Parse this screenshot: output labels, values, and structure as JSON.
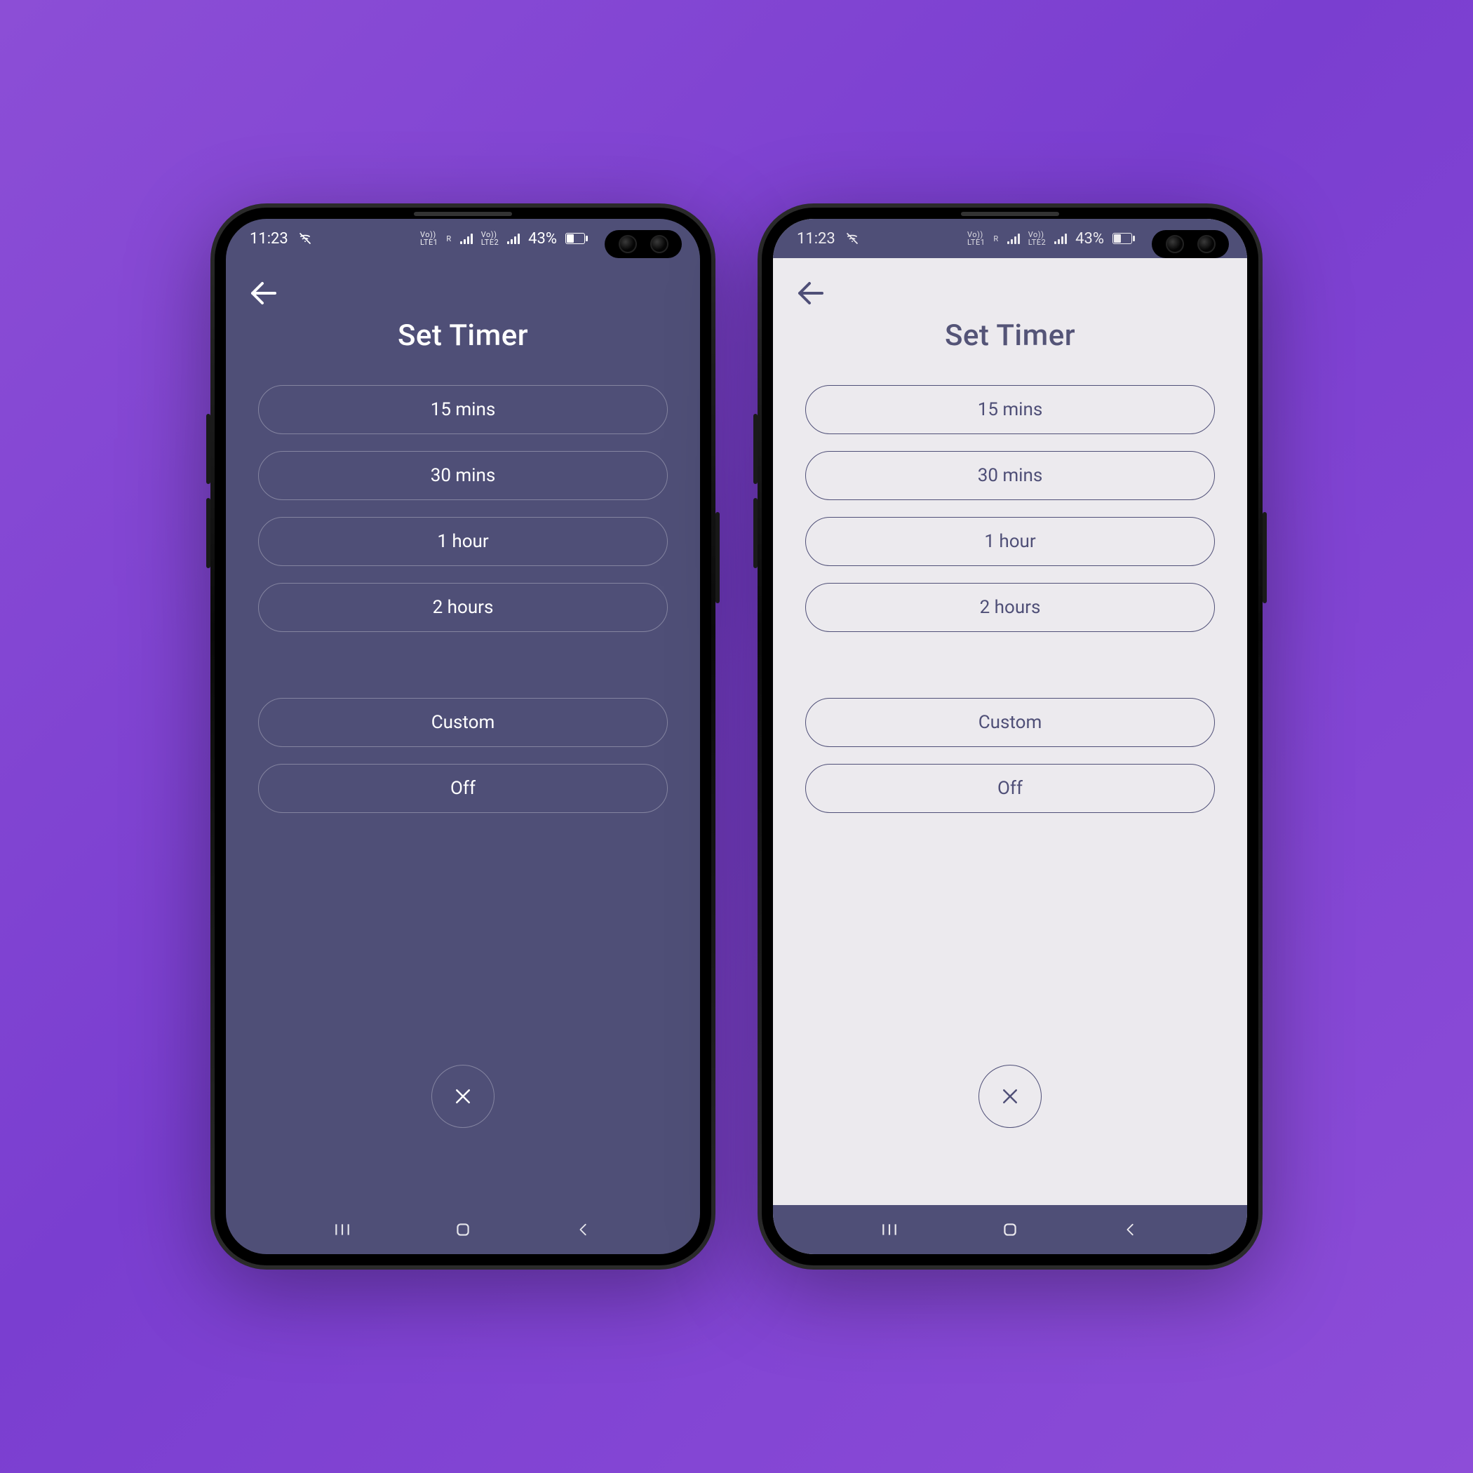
{
  "status": {
    "time": "11:23",
    "battery_pct": "43%",
    "sim1_top": "Vo))",
    "sim1_bot": "LTE1",
    "sim1_flag": "R",
    "sim2_top": "Vo))",
    "sim2_bot": "LTE2"
  },
  "screens": [
    {
      "theme": "dark",
      "title": "Set Timer"
    },
    {
      "theme": "light",
      "title": "Set Timer"
    }
  ],
  "timer_options": {
    "group_a": [
      "15 mins",
      "30 mins",
      "1 hour",
      "2 hours"
    ],
    "group_b": [
      "Custom",
      "Off"
    ]
  },
  "colors": {
    "brand_navy": "#4f4f77",
    "surface_light": "#eceaee",
    "bg_gradient_from": "#8c4ed6",
    "bg_gradient_to": "#8d4dd8"
  }
}
